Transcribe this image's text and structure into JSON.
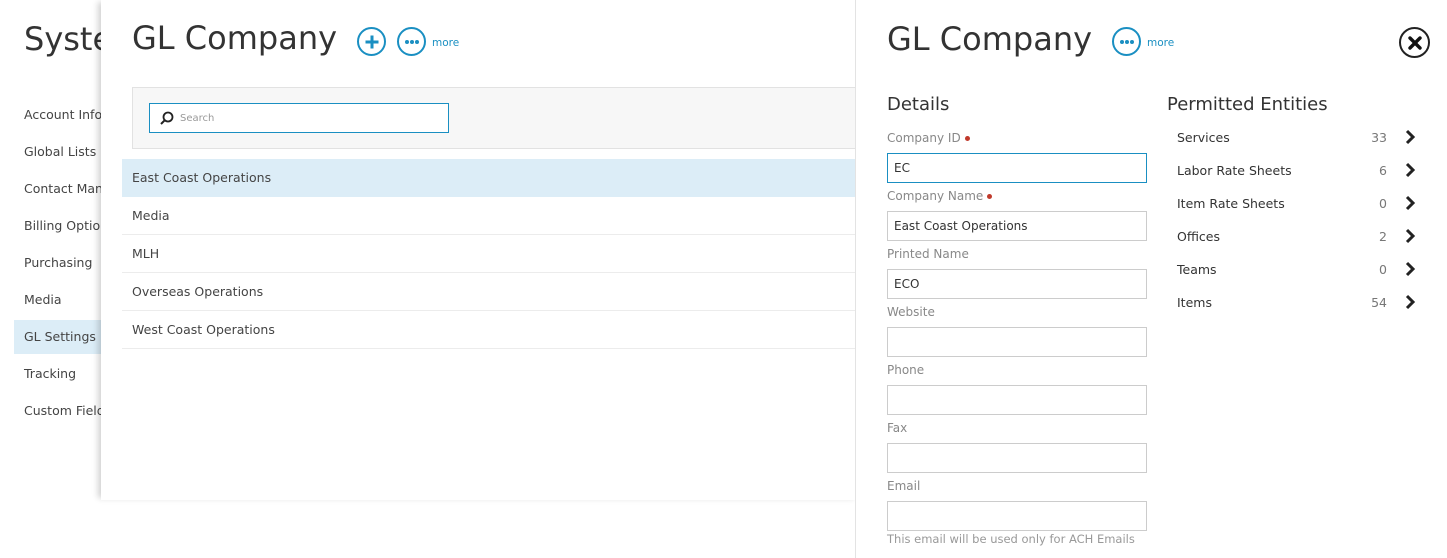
{
  "system_panel": {
    "title": "System Settings",
    "items": [
      {
        "label": "Account Information",
        "active": false
      },
      {
        "label": "Global Lists",
        "active": false
      },
      {
        "label": "Contact Management",
        "active": false
      },
      {
        "label": "Billing Options",
        "active": false
      },
      {
        "label": "Purchasing",
        "active": false
      },
      {
        "label": "Media",
        "active": false
      },
      {
        "label": "GL Settings",
        "active": true
      },
      {
        "label": "Tracking",
        "active": false
      },
      {
        "label": "Custom Fields",
        "active": false
      }
    ]
  },
  "list_panel": {
    "title": "GL Company",
    "more_label": "more",
    "search": {
      "placeholder": "Search",
      "value": ""
    },
    "rows": [
      {
        "label": "East Coast Operations",
        "selected": true
      },
      {
        "label": "Media",
        "selected": false
      },
      {
        "label": "MLH",
        "selected": false
      },
      {
        "label": "Overseas Operations",
        "selected": false
      },
      {
        "label": "West Coast Operations",
        "selected": false
      }
    ]
  },
  "detail_panel": {
    "title": "GL Company",
    "more_label": "more",
    "details_heading": "Details",
    "fields": {
      "company_id": {
        "label": "Company ID",
        "value": "EC",
        "required": true
      },
      "company_name": {
        "label": "Company Name",
        "value": "East Coast Operations",
        "required": true
      },
      "printed_name": {
        "label": "Printed Name",
        "value": "ECO"
      },
      "website": {
        "label": "Website",
        "value": ""
      },
      "phone": {
        "label": "Phone",
        "value": ""
      },
      "fax": {
        "label": "Fax",
        "value": ""
      },
      "email": {
        "label": "Email",
        "value": ""
      }
    },
    "email_note": "This email will be used only for ACH Emails",
    "permitted_heading": "Permitted Entities",
    "entities": [
      {
        "label": "Services",
        "count": "33"
      },
      {
        "label": "Labor Rate Sheets",
        "count": "6"
      },
      {
        "label": "Item Rate Sheets",
        "count": "0"
      },
      {
        "label": "Offices",
        "count": "2"
      },
      {
        "label": "Teams",
        "count": "0"
      },
      {
        "label": "Items",
        "count": "54"
      }
    ]
  },
  "colors": {
    "accent": "#1a8fc2",
    "selected_row": "#dcedf7",
    "required": "#c0392b"
  },
  "icons": {
    "add": "plus-circle-icon",
    "more": "ellipsis-circle-icon",
    "search": "search-icon",
    "close": "close-circle-icon",
    "chevron": "chevron-right-icon"
  }
}
